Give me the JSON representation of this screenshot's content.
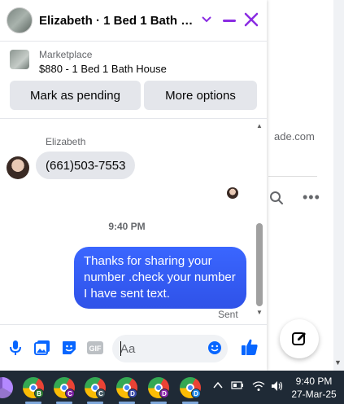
{
  "chat": {
    "title": "Elizabeth · 1 Bed 1 Bath Ho...",
    "marketplace_label": "Marketplace",
    "listing": "$880 - 1 Bed 1 Bath House",
    "mark_pending_label": "Mark as pending",
    "more_options_label": "More options",
    "sender_name": "Elizabeth",
    "incoming_message": "(661)503-7553",
    "timestamp": "9:40 PM",
    "outgoing_message": "Thanks for sharing your number .check your number I have sent text.",
    "sent_status": "Sent",
    "input_placeholder": "Aa",
    "gif_label": "GIF"
  },
  "background": {
    "url_fragment": "ade.com"
  },
  "taskbar": {
    "apps": [
      {
        "badge": "B",
        "badge_color": "#2e7d32"
      },
      {
        "badge": "C",
        "badge_color": "#7b1fa2"
      },
      {
        "badge": "C",
        "badge_color": "#455a64"
      },
      {
        "badge": "D",
        "badge_color": "#3949ab"
      },
      {
        "badge": "D",
        "badge_color": "#8e24aa"
      },
      {
        "badge": "D",
        "badge_color": "#1e88e5"
      }
    ],
    "time": "9:40 PM",
    "date": "27-Mar-25"
  },
  "colors": {
    "accent": "#8a2be2",
    "outgoing_bubble": "#2f52e8",
    "messenger_blue": "#0866ff",
    "taskbar": "#1f2a36"
  }
}
